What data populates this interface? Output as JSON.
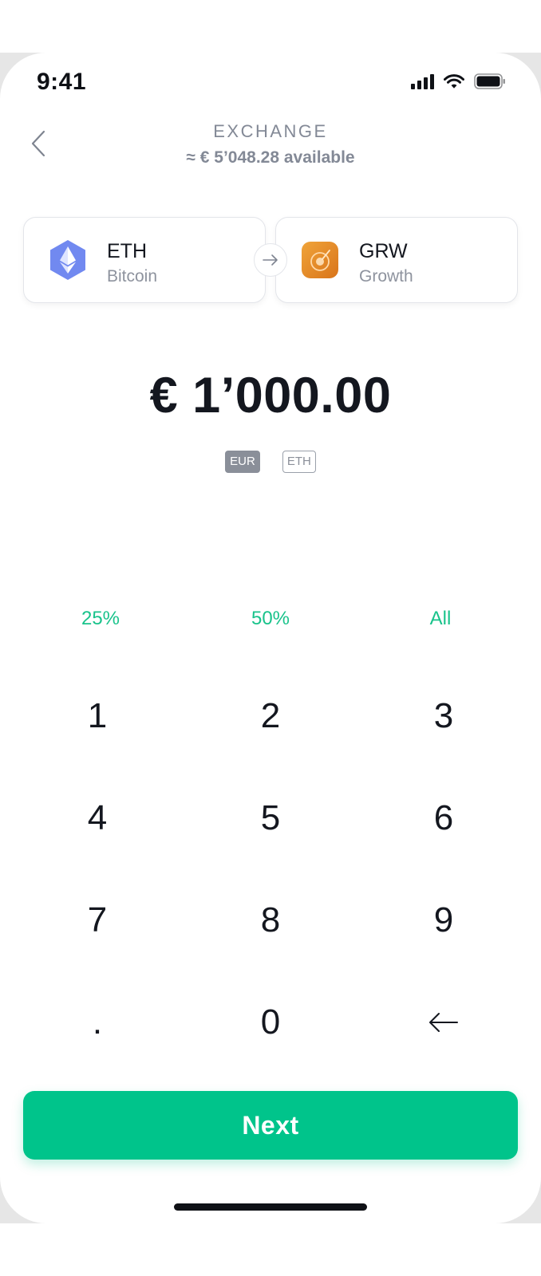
{
  "status_bar": {
    "time": "9:41"
  },
  "header": {
    "title": "EXCHANGE",
    "available": "≈ € 5’048.28 available"
  },
  "from_asset": {
    "symbol": "ETH",
    "name": "Bitcoin",
    "icon": "ethereum-icon",
    "color": "#6f86f0"
  },
  "to_asset": {
    "symbol": "GRW",
    "name": "Growth",
    "icon": "growth-icon",
    "color": "#e58a25"
  },
  "amount": "€ 1’000.00",
  "currency_toggle": {
    "active": "EUR",
    "inactive": "ETH"
  },
  "percentages": [
    "25%",
    "50%",
    "All"
  ],
  "keypad": [
    "1",
    "2",
    "3",
    "4",
    "5",
    "6",
    "7",
    "8",
    "9",
    ".",
    "0",
    "backspace-icon"
  ],
  "next_button": "Next",
  "colors": {
    "accent": "#00c48b",
    "text": "#14171f",
    "muted": "#838996"
  }
}
